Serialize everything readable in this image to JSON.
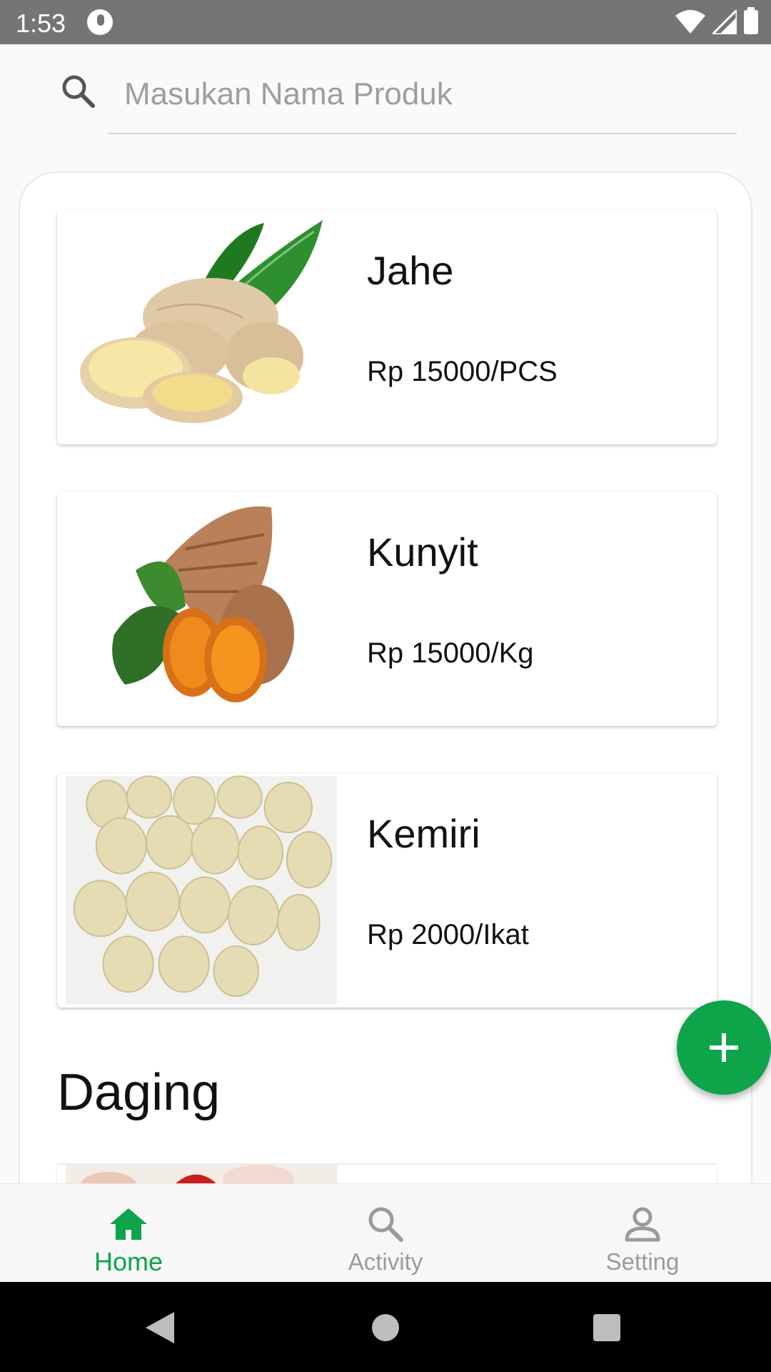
{
  "status_bar": {
    "time": "1:53"
  },
  "search": {
    "placeholder": "Masukan Nama Produk",
    "icon": "search-icon"
  },
  "products": [
    {
      "name": "Jahe",
      "price": "Rp 15000/PCS",
      "image": "ginger-image"
    },
    {
      "name": "Kunyit",
      "price": "Rp 15000/Kg",
      "image": "turmeric-image"
    },
    {
      "name": "Kemiri",
      "price": "Rp 2000/Ikat",
      "image": "candlenut-image"
    }
  ],
  "section": {
    "title": "Daging"
  },
  "fab": {
    "icon": "plus-icon"
  },
  "bottom_nav": {
    "items": [
      {
        "label": "Home",
        "icon": "home-icon",
        "active": true
      },
      {
        "label": "Activity",
        "icon": "search-icon",
        "active": false
      },
      {
        "label": "Setting",
        "icon": "person-icon",
        "active": false
      }
    ]
  },
  "colors": {
    "accent": "#0da44a",
    "status_bar": "#757575",
    "inactive": "#9b9b9b"
  }
}
